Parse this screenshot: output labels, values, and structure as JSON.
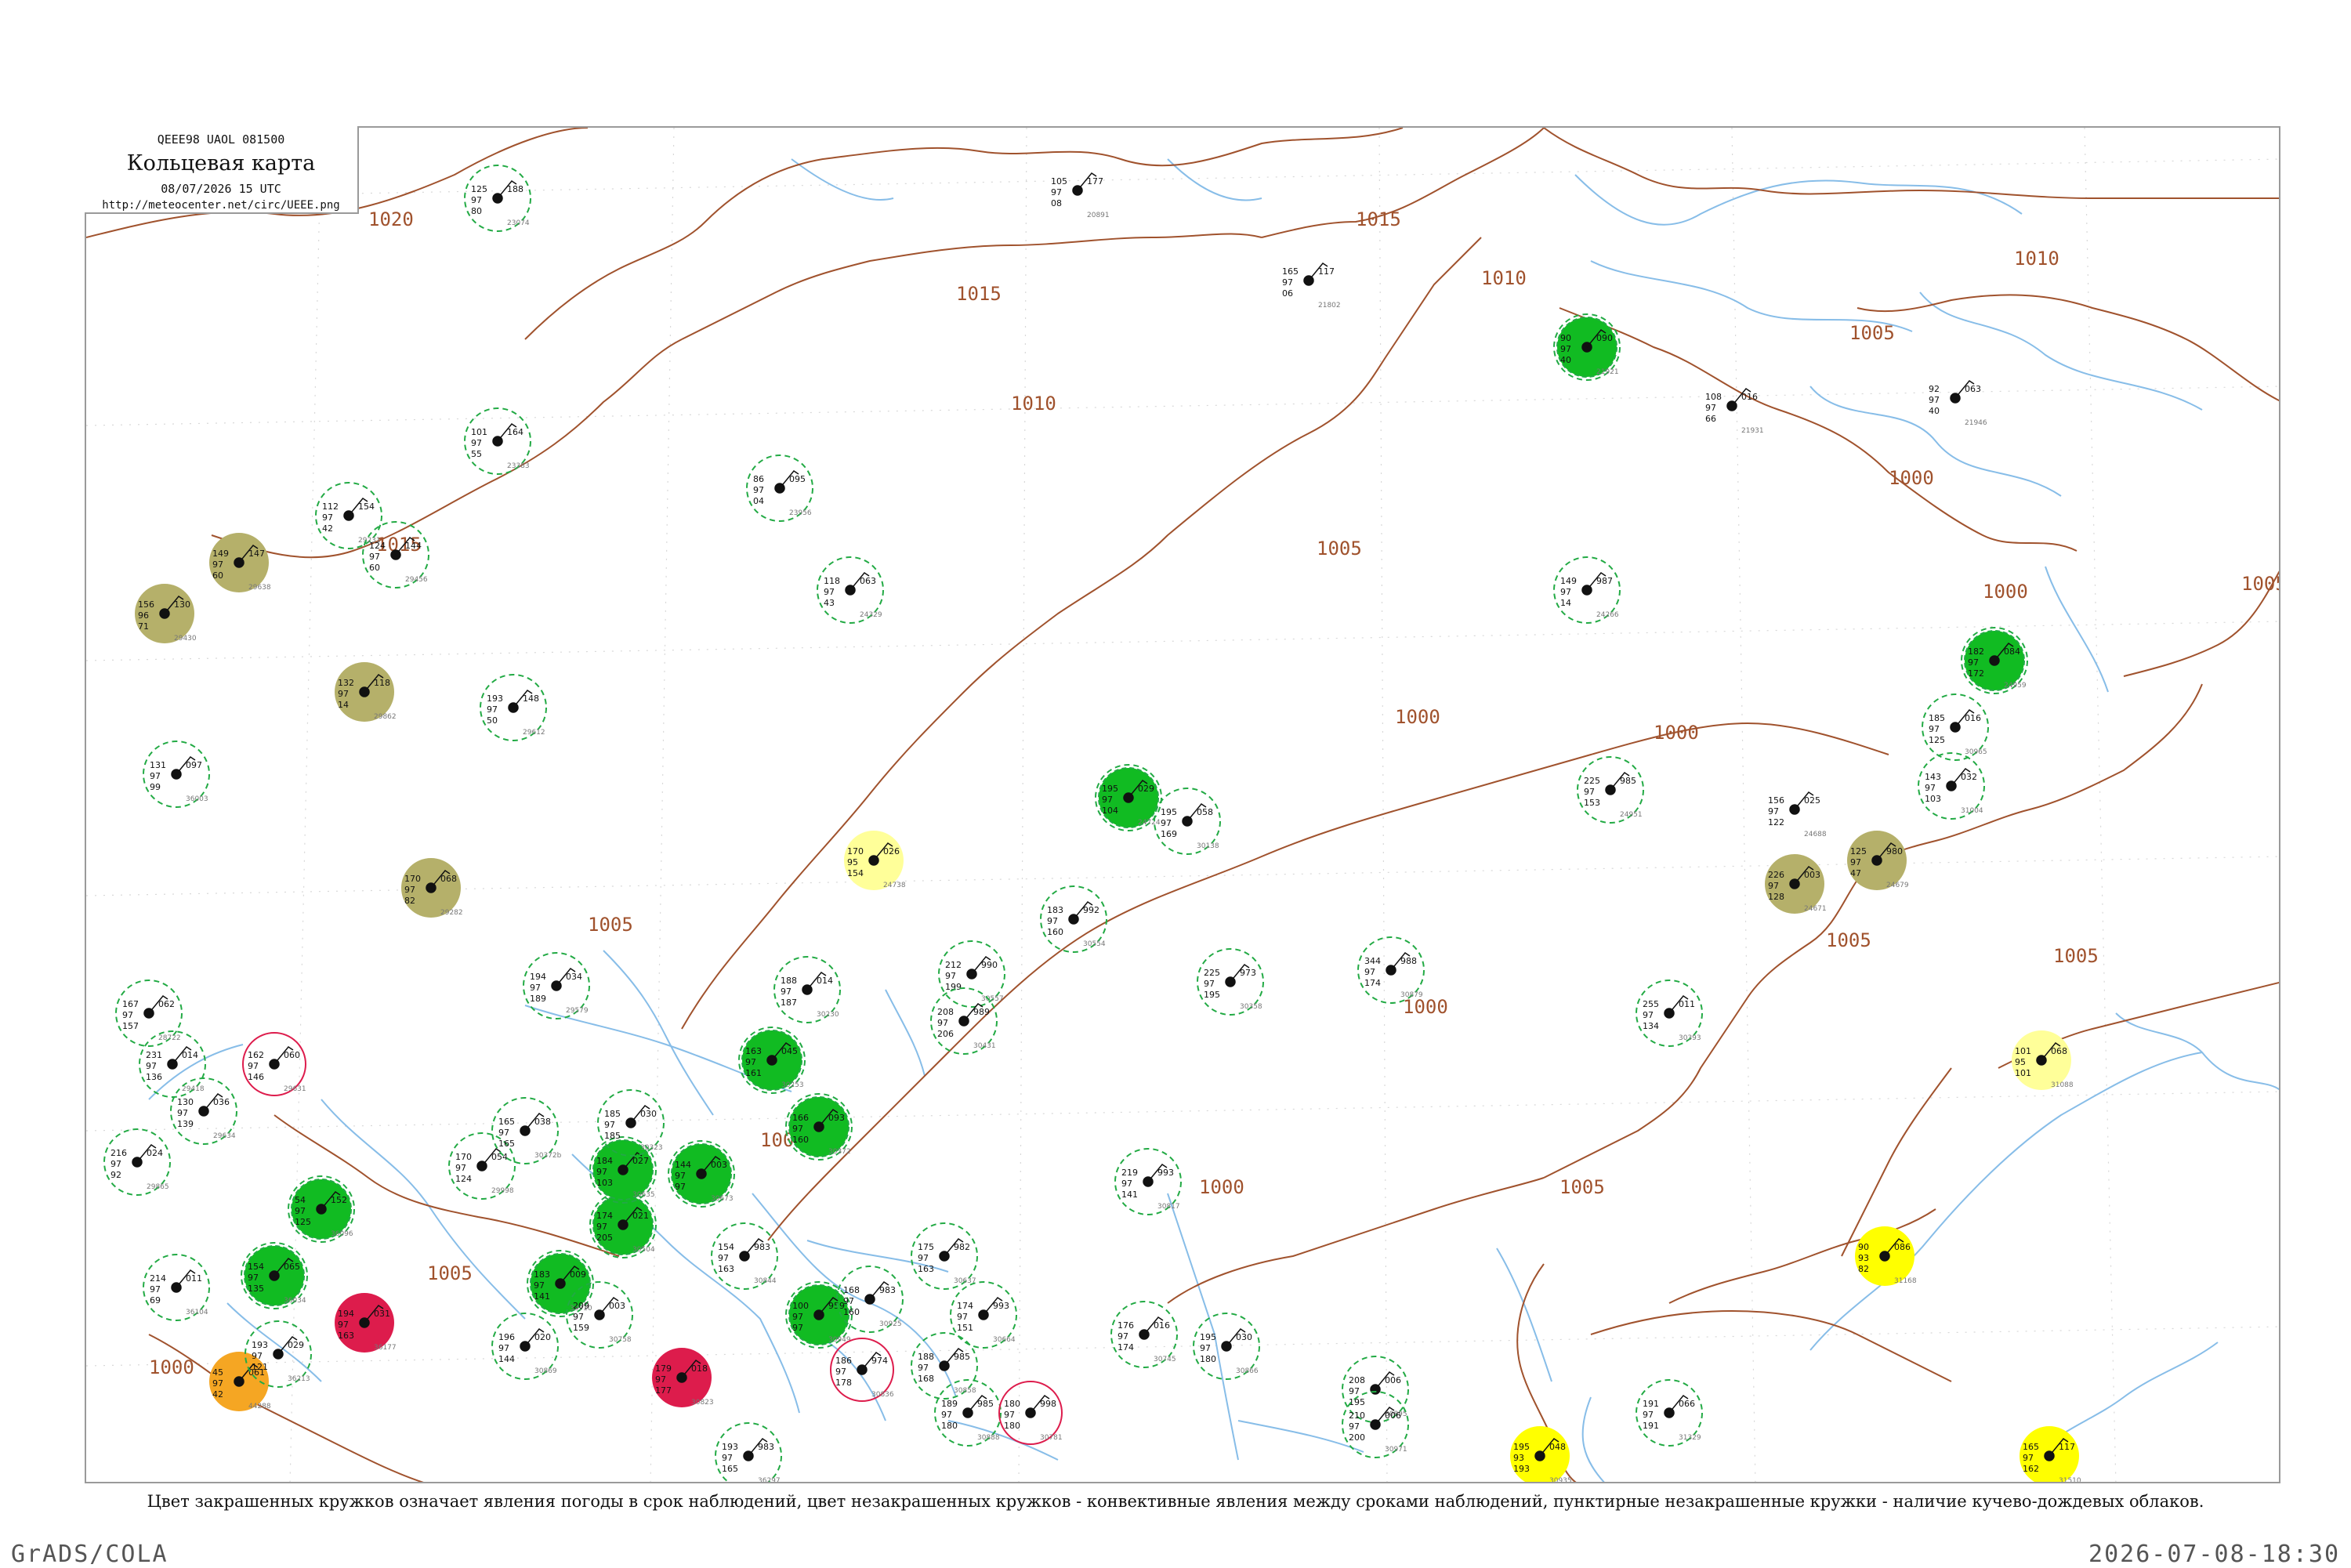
{
  "header": {
    "code": "QEEE98  UAOL  081500",
    "title": "Кольцевая карта",
    "time": "08/07/2026 15 UTC",
    "url": "http://meteocenter.net/circ/UEEE.png"
  },
  "caption": "Цвет закрашенных кружков означает явления погоды в срок наблюдений, цвет незакрашенных кружков - конвективные явления между сроками наблюдений, пунктирные незакрашенные кружки - наличие кучево-дождевых облаков.",
  "footer": {
    "left": "GrADS/COLA",
    "right": "2026-07-08-18:30"
  },
  "colors": {
    "isobar": "#a0522d",
    "river": "#87bde8",
    "cb_ring": "#22aa44",
    "rain": "#11bb22",
    "shower_light": "#ffff00",
    "shower_pale": "#ffff99",
    "haze": "#b5b06a",
    "thunderstorm": "#dd1c4c",
    "dust": "#f5a623"
  },
  "isobar_labels": [
    {
      "id": "iso-1020-nw",
      "text": "1020"
    },
    {
      "id": "iso-1015-n",
      "text": "1015"
    },
    {
      "id": "iso-1015-ne",
      "text": "1015"
    },
    {
      "id": "iso-1015-w",
      "text": "1015"
    },
    {
      "id": "iso-1010-ne",
      "text": "1010"
    },
    {
      "id": "iso-1010-c",
      "text": "1010"
    },
    {
      "id": "iso-1010-far-ne",
      "text": "1010"
    },
    {
      "id": "iso-1005-ne",
      "text": "1005"
    },
    {
      "id": "iso-1005-c",
      "text": "1005"
    },
    {
      "id": "iso-1005-e",
      "text": "1005"
    },
    {
      "id": "iso-1005-sw",
      "text": "1005"
    },
    {
      "id": "iso-1005-w",
      "text": "1005"
    },
    {
      "id": "iso-1005-se",
      "text": "1005"
    },
    {
      "id": "iso-1005-s",
      "text": "1005"
    },
    {
      "id": "iso-1005-s2",
      "text": "1005"
    },
    {
      "id": "iso-1000-c",
      "text": "1000"
    },
    {
      "id": "iso-1000-ne",
      "text": "1000"
    },
    {
      "id": "iso-1000-e",
      "text": "1000"
    },
    {
      "id": "iso-1000-e2",
      "text": "1000"
    },
    {
      "id": "iso-1000-s",
      "text": "1000"
    },
    {
      "id": "iso-1000-s2",
      "text": "1000"
    },
    {
      "id": "iso-1000-sw",
      "text": "1000"
    },
    {
      "id": "iso-1000-c2",
      "text": "1000"
    }
  ],
  "stations": [
    {
      "id": "24266",
      "t": "149",
      "td": "97",
      "p": "987",
      "w": "14",
      "ring": "cb",
      "fill": ""
    },
    {
      "id": "20891",
      "t": "105",
      "td": "97",
      "p": "177",
      "w": "08",
      "ring": "",
      "fill": ""
    },
    {
      "id": "21802",
      "t": "165",
      "td": "97",
      "p": "117",
      "w": "06",
      "ring": "",
      "fill": ""
    },
    {
      "id": "21921",
      "t": "90",
      "td": "97",
      "p": "090",
      "w": "40",
      "ring": "cb",
      "fill": "rain"
    },
    {
      "id": "21931",
      "t": "108",
      "td": "97",
      "p": "016",
      "w": "66",
      "ring": "",
      "fill": ""
    },
    {
      "id": "21946",
      "t": "92",
      "td": "97",
      "p": "063",
      "w": "40",
      "ring": "",
      "fill": ""
    },
    {
      "id": "24959",
      "t": "182",
      "td": "97",
      "p": "084",
      "w": "172",
      "ring": "cb",
      "fill": "rain"
    },
    {
      "id": "24688",
      "t": "156",
      "td": "97",
      "p": "025",
      "w": "122",
      "ring": "",
      "fill": ""
    },
    {
      "id": "24679",
      "t": "125",
      "td": "97",
      "p": "980",
      "w": "47",
      "ring": "",
      "fill": "haze"
    },
    {
      "id": "24671",
      "t": "226",
      "td": "97",
      "p": "003",
      "w": "128",
      "ring": "",
      "fill": "haze"
    },
    {
      "id": "31088",
      "t": "101",
      "td": "95",
      "p": "068",
      "w": "101",
      "ring": "",
      "fill": "shower_pale"
    },
    {
      "id": "31168",
      "t": "90",
      "td": "93",
      "p": "086",
      "w": "82",
      "ring": "",
      "fill": "shower_light"
    },
    {
      "id": "24738",
      "t": "170",
      "td": "95",
      "p": "026",
      "w": "154",
      "ring": "",
      "fill": "shower_pale"
    },
    {
      "id": "24724",
      "t": "195",
      "td": "97",
      "p": "029",
      "w": "104",
      "ring": "cb",
      "fill": "rain"
    },
    {
      "id": "30253",
      "t": "163",
      "td": "97",
      "p": "045",
      "w": "161",
      "ring": "cb",
      "fill": "rain"
    },
    {
      "id": "30372",
      "t": "166",
      "td": "97",
      "p": "093",
      "w": "160",
      "ring": "cb",
      "fill": "rain"
    },
    {
      "id": "30504",
      "t": "174",
      "td": "97",
      "p": "021",
      "w": "205",
      "ring": "cb",
      "fill": "rain"
    },
    {
      "id": "30710",
      "t": "183",
      "td": "97",
      "p": "009",
      "w": "141",
      "ring": "cb",
      "fill": "rain"
    },
    {
      "id": "30673",
      "t": "144",
      "td": "97",
      "p": "003",
      "w": "97",
      "ring": "cb",
      "fill": "rain"
    },
    {
      "id": "30949",
      "t": "100",
      "td": "97",
      "p": "959",
      "w": "97",
      "ring": "cb",
      "fill": "rain"
    },
    {
      "id": "30823",
      "t": "179",
      "td": "97",
      "p": "018",
      "w": "177",
      "ring": "",
      "fill": "thunderstorm"
    },
    {
      "id": "30635",
      "t": "184",
      "td": "97",
      "p": "027",
      "w": "103",
      "ring": "cb",
      "fill": "rain"
    },
    {
      "id": "36096",
      "t": "54",
      "td": "97",
      "p": "152",
      "w": "125",
      "ring": "cb",
      "fill": "rain"
    },
    {
      "id": "36034",
      "t": "154",
      "td": "97",
      "p": "065",
      "w": "135",
      "ring": "cb",
      "fill": "rain"
    },
    {
      "id": "36177",
      "t": "194",
      "td": "97",
      "p": "031",
      "w": "163",
      "ring": "",
      "fill": "thunderstorm"
    },
    {
      "id": "44288",
      "t": "45",
      "td": "97",
      "p": "061",
      "w": "42",
      "ring": "",
      "fill": "dust"
    },
    {
      "id": "30935",
      "t": "195",
      "td": "93",
      "p": "048",
      "w": "193",
      "ring": "",
      "fill": "shower_light"
    },
    {
      "id": "31510",
      "t": "165",
      "td": "97",
      "p": "117",
      "w": "162",
      "ring": "",
      "fill": "shower_light"
    },
    {
      "id": "29638",
      "t": "149",
      "td": "97",
      "p": "147",
      "w": "60",
      "ring": "",
      "fill": "haze"
    },
    {
      "id": "29430",
      "t": "156",
      "td": "96",
      "p": "130",
      "w": "71",
      "ring": "",
      "fill": "haze"
    },
    {
      "id": "29862",
      "t": "132",
      "td": "97",
      "p": "118",
      "w": "14",
      "ring": "",
      "fill": "haze"
    },
    {
      "id": "29282",
      "t": "170",
      "td": "97",
      "p": "068",
      "w": "82",
      "ring": "",
      "fill": "haze"
    },
    {
      "id": "23074",
      "t": "125",
      "td": "97",
      "p": "188",
      "w": "80",
      "ring": "cb",
      "fill": ""
    },
    {
      "id": "23383",
      "t": "101",
      "td": "97",
      "p": "164",
      "w": "55",
      "ring": "cb",
      "fill": ""
    },
    {
      "id": "23956",
      "t": "86",
      "td": "97",
      "p": "095",
      "w": "04",
      "ring": "cb",
      "fill": ""
    },
    {
      "id": "24329",
      "t": "118",
      "td": "97",
      "p": "063",
      "w": "43",
      "ring": "cb",
      "fill": ""
    },
    {
      "id": "29231",
      "t": "112",
      "td": "97",
      "p": "154",
      "w": "42",
      "ring": "cb",
      "fill": ""
    },
    {
      "id": "29456",
      "t": "124",
      "td": "97",
      "p": "144",
      "w": "60",
      "ring": "cb",
      "fill": ""
    },
    {
      "id": "29612",
      "t": "193",
      "td": "97",
      "p": "148",
      "w": "50",
      "ring": "cb",
      "fill": ""
    },
    {
      "id": "36003",
      "t": "131",
      "td": "97",
      "p": "097",
      "w": "99",
      "ring": "cb",
      "fill": ""
    },
    {
      "id": "30965",
      "t": "185",
      "td": "97",
      "p": "016",
      "w": "125",
      "ring": "cb",
      "fill": ""
    },
    {
      "id": "31004",
      "t": "143",
      "td": "97",
      "p": "032",
      "w": "103",
      "ring": "cb",
      "fill": ""
    },
    {
      "id": "24951",
      "t": "225",
      "td": "97",
      "p": "985",
      "w": "153",
      "ring": "cb",
      "fill": ""
    },
    {
      "id": "30138",
      "t": "195",
      "td": "97",
      "p": "058",
      "w": "169",
      "ring": "cb",
      "fill": ""
    },
    {
      "id": "30554",
      "t": "183",
      "td": "97",
      "p": "992",
      "w": "160",
      "ring": "cb",
      "fill": ""
    },
    {
      "id": "30557",
      "t": "212",
      "td": "97",
      "p": "990",
      "w": "199",
      "ring": "cb",
      "fill": ""
    },
    {
      "id": "30358",
      "t": "225",
      "td": "97",
      "p": "973",
      "w": "195",
      "ring": "cb",
      "fill": ""
    },
    {
      "id": "30879",
      "t": "344",
      "td": "97",
      "p": "988",
      "w": "174",
      "ring": "cb",
      "fill": ""
    },
    {
      "id": "30393",
      "t": "255",
      "td": "97",
      "p": "011",
      "w": "134",
      "ring": "cb",
      "fill": ""
    },
    {
      "id": "30431",
      "t": "208",
      "td": "97",
      "p": "989",
      "w": "206",
      "ring": "cb",
      "fill": ""
    },
    {
      "id": "30230",
      "t": "188",
      "td": "97",
      "p": "014",
      "w": "187",
      "ring": "cb",
      "fill": ""
    },
    {
      "id": "29579",
      "t": "194",
      "td": "97",
      "p": "034",
      "w": "189",
      "ring": "cb",
      "fill": ""
    },
    {
      "id": "28722",
      "t": "167",
      "td": "97",
      "p": "062",
      "w": "157",
      "ring": "cb",
      "fill": ""
    },
    {
      "id": "29418",
      "t": "231",
      "td": "97",
      "p": "014",
      "w": "136",
      "ring": "cb",
      "fill": ""
    },
    {
      "id": "29631",
      "t": "162",
      "td": "97",
      "p": "060",
      "w": "146",
      "ring": "tstorm",
      "fill": ""
    },
    {
      "id": "29634",
      "t": "130",
      "td": "97",
      "p": "036",
      "w": "139",
      "ring": "cb",
      "fill": ""
    },
    {
      "id": "29865",
      "t": "216",
      "td": "97",
      "p": "024",
      "w": "92",
      "ring": "cb",
      "fill": ""
    },
    {
      "id": "29998",
      "t": "170",
      "td": "97",
      "p": "054",
      "w": "124",
      "ring": "cb",
      "fill": ""
    },
    {
      "id": "30372b",
      "t": "165",
      "td": "97",
      "p": "038",
      "w": "165",
      "ring": "cb",
      "fill": ""
    },
    {
      "id": "30323",
      "t": "185",
      "td": "97",
      "p": "030",
      "w": "185",
      "ring": "cb",
      "fill": ""
    },
    {
      "id": "36104",
      "t": "214",
      "td": "97",
      "p": "011",
      "w": "69",
      "ring": "cb",
      "fill": ""
    },
    {
      "id": "36213",
      "t": "193",
      "td": "97",
      "p": "029",
      "w": "121",
      "ring": "cb",
      "fill": ""
    },
    {
      "id": "30758",
      "t": "209",
      "td": "97",
      "p": "003",
      "w": "159",
      "ring": "cb",
      "fill": ""
    },
    {
      "id": "30869",
      "t": "196",
      "td": "97",
      "p": "020",
      "w": "144",
      "ring": "cb",
      "fill": ""
    },
    {
      "id": "30844",
      "t": "154",
      "td": "97",
      "p": "983",
      "w": "163",
      "ring": "cb",
      "fill": ""
    },
    {
      "id": "30925",
      "t": "168",
      "td": "97",
      "p": "983",
      "w": "160",
      "ring": "cb",
      "fill": ""
    },
    {
      "id": "30637",
      "t": "175",
      "td": "97",
      "p": "982",
      "w": "163",
      "ring": "cb",
      "fill": ""
    },
    {
      "id": "30664",
      "t": "174",
      "td": "97",
      "p": "993",
      "w": "151",
      "ring": "cb",
      "fill": ""
    },
    {
      "id": "30836",
      "t": "186",
      "td": "97",
      "p": "974",
      "w": "178",
      "ring": "tstorm",
      "fill": ""
    },
    {
      "id": "30858",
      "t": "188",
      "td": "97",
      "p": "985",
      "w": "168",
      "ring": "cb",
      "fill": ""
    },
    {
      "id": "30888",
      "t": "189",
      "td": "97",
      "p": "985",
      "w": "180",
      "ring": "cb",
      "fill": ""
    },
    {
      "id": "30781",
      "t": "180",
      "td": "97",
      "p": "998",
      "w": "180",
      "ring": "tstorm",
      "fill": ""
    },
    {
      "id": "30745",
      "t": "176",
      "td": "97",
      "p": "016",
      "w": "174",
      "ring": "cb",
      "fill": ""
    },
    {
      "id": "30866",
      "t": "195",
      "td": "97",
      "p": "030",
      "w": "180",
      "ring": "cb",
      "fill": ""
    },
    {
      "id": "30895",
      "t": "208",
      "td": "97",
      "p": "006",
      "w": "195",
      "ring": "cb",
      "fill": ""
    },
    {
      "id": "30971",
      "t": "210",
      "td": "97",
      "p": "006",
      "w": "200",
      "ring": "cb",
      "fill": ""
    },
    {
      "id": "36297",
      "t": "193",
      "td": "97",
      "p": "983",
      "w": "165",
      "ring": "cb",
      "fill": ""
    },
    {
      "id": "31329",
      "t": "191",
      "td": "97",
      "p": "066",
      "w": "191",
      "ring": "cb",
      "fill": ""
    },
    {
      "id": "30817",
      "t": "219",
      "td": "97",
      "p": "993",
      "w": "141",
      "ring": "cb",
      "fill": ""
    }
  ]
}
